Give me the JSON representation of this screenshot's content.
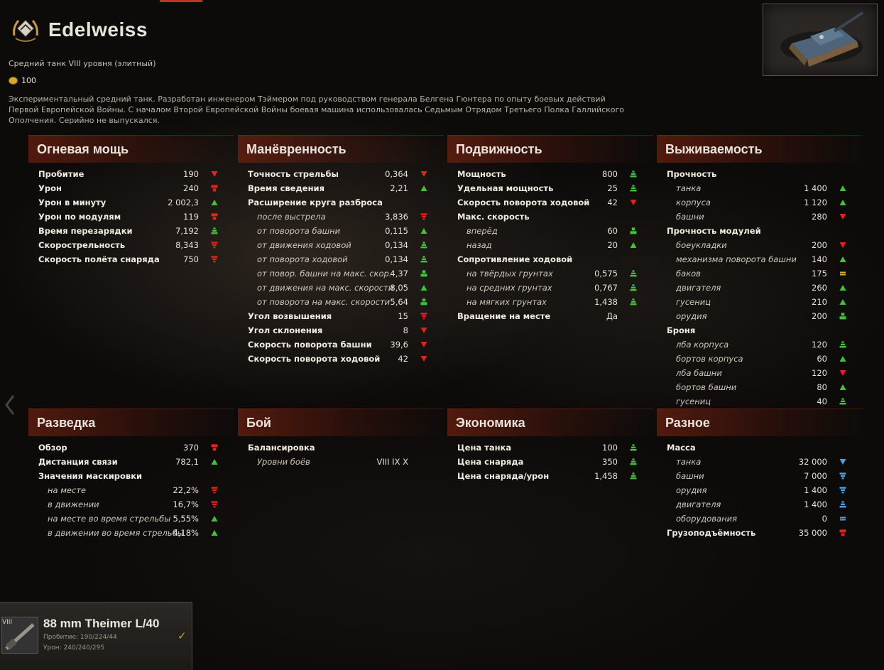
{
  "tank": {
    "name": "Edelweiss",
    "subtitle": "Средний танк VIII уровня (элитный)",
    "price": "100",
    "description": "Экспериментальный средний танк. Разработан инженером Тэймером под руководством генерала Белгена Гюнтера по опыту боевых действий Первой Европейской Войны. С началом Второй Европейской Войны боевая машина использовалась Седьмым Отрядом Третьего Полка Галлийского Ополчения. Серийно не выпускался."
  },
  "sections": {
    "firepower": {
      "title": "Огневая мощь",
      "rows": [
        {
          "label": "Пробитие",
          "value": "190",
          "ind": "down"
        },
        {
          "label": "Урон",
          "value": "240",
          "ind": "down2"
        },
        {
          "label": "Урон в минуту",
          "value": "2 002,3",
          "ind": "up"
        },
        {
          "label": "Урон по модулям",
          "value": "119",
          "ind": "down2"
        },
        {
          "label": "Время перезарядки",
          "value": "7,192",
          "ind": "up3"
        },
        {
          "label": "Скорострельность",
          "value": "8,343",
          "ind": "down3"
        },
        {
          "label": "Скорость полёта снаряда",
          "value": "750",
          "ind": "down3"
        }
      ]
    },
    "maneuver": {
      "title": "Манёвренность",
      "rows": [
        {
          "label": "Точность стрельбы",
          "value": "0,364",
          "ind": "down"
        },
        {
          "label": "Время сведения",
          "value": "2,21",
          "ind": "up"
        },
        {
          "label": "Расширение круга разброса",
          "value": "",
          "ind": ""
        },
        {
          "label": "после выстрела",
          "value": "3,836",
          "ind": "down3",
          "sub": true
        },
        {
          "label": "от поворота башни",
          "value": "0,115",
          "ind": "up",
          "sub": true
        },
        {
          "label": "от движения ходовой",
          "value": "0,134",
          "ind": "up3",
          "sub": true
        },
        {
          "label": "от поворота ходовой",
          "value": "0,134",
          "ind": "up3",
          "sub": true
        },
        {
          "label": "от повор. башни на макс. скор.",
          "value": "4,37",
          "ind": "up2",
          "sub": true
        },
        {
          "label": "от движения на макс. скорости",
          "value": "8,05",
          "ind": "up",
          "sub": true
        },
        {
          "label": "от поворота на макс. скорости",
          "value": "5,64",
          "ind": "up2",
          "sub": true
        },
        {
          "label": "Угол возвышения",
          "value": "15",
          "ind": "down3"
        },
        {
          "label": "Угол склонения",
          "value": "8",
          "ind": "down"
        },
        {
          "label": "Скорость поворота башни",
          "value": "39,6",
          "ind": "down"
        },
        {
          "label": "Скорость поворота ходовой",
          "value": "42",
          "ind": "down"
        }
      ]
    },
    "mobility": {
      "title": "Подвижность",
      "rows": [
        {
          "label": "Мощность",
          "value": "800",
          "ind": "up3"
        },
        {
          "label": "Удельная мощность",
          "value": "25",
          "ind": "up3"
        },
        {
          "label": "Скорость поворота ходовой",
          "value": "42",
          "ind": "down"
        },
        {
          "label": "Макс. скорость",
          "value": "",
          "ind": ""
        },
        {
          "label": "вперёд",
          "value": "60",
          "ind": "up2",
          "sub": true
        },
        {
          "label": "назад",
          "value": "20",
          "ind": "up",
          "sub": true
        },
        {
          "label": "Сопротивление ходовой",
          "value": "",
          "ind": ""
        },
        {
          "label": "на твёрдых грунтах",
          "value": "0,575",
          "ind": "up3",
          "sub": true
        },
        {
          "label": "на средних грунтах",
          "value": "0,767",
          "ind": "up3",
          "sub": true
        },
        {
          "label": "на мягких грунтах",
          "value": "1,438",
          "ind": "up3",
          "sub": true
        },
        {
          "label": "Вращение на месте",
          "value": "Да",
          "ind": ""
        }
      ]
    },
    "survivability": {
      "title": "Выживаемость",
      "rows": [
        {
          "label": "Прочность",
          "value": "",
          "ind": ""
        },
        {
          "label": "танка",
          "value": "1 400",
          "ind": "up",
          "sub": true
        },
        {
          "label": "корпуса",
          "value": "1 120",
          "ind": "up",
          "sub": true
        },
        {
          "label": "башни",
          "value": "280",
          "ind": "down",
          "sub": true
        },
        {
          "label": "Прочность модулей",
          "value": "",
          "ind": ""
        },
        {
          "label": "боеукладки",
          "value": "200",
          "ind": "down",
          "sub": true
        },
        {
          "label": "механизма поворота башни",
          "value": "140",
          "ind": "up",
          "sub": true
        },
        {
          "label": "баков",
          "value": "175",
          "ind": "equal_y",
          "sub": true
        },
        {
          "label": "двигателя",
          "value": "260",
          "ind": "up",
          "sub": true
        },
        {
          "label": "гусениц",
          "value": "210",
          "ind": "up",
          "sub": true
        },
        {
          "label": "орудия",
          "value": "200",
          "ind": "up2",
          "sub": true
        },
        {
          "label": "Броня",
          "value": "",
          "ind": ""
        },
        {
          "label": "лба корпуса",
          "value": "120",
          "ind": "up3",
          "sub": true
        },
        {
          "label": "бортов корпуса",
          "value": "60",
          "ind": "up",
          "sub": true
        },
        {
          "label": "лба башни",
          "value": "120",
          "ind": "down",
          "sub": true
        },
        {
          "label": "бортов башни",
          "value": "80",
          "ind": "up",
          "sub": true
        },
        {
          "label": "гусениц",
          "value": "40",
          "ind": "up3",
          "sub": true
        }
      ]
    },
    "recon": {
      "title": "Разведка",
      "rows": [
        {
          "label": "Обзор",
          "value": "370",
          "ind": "down2"
        },
        {
          "label": "Дистанция связи",
          "value": "782,1",
          "ind": "up"
        },
        {
          "label": "Значения маскировки",
          "value": "",
          "ind": ""
        },
        {
          "label": "на месте",
          "value": "22,2%",
          "ind": "down3",
          "sub": true
        },
        {
          "label": "в движении",
          "value": "16,7%",
          "ind": "down3",
          "sub": true
        },
        {
          "label": "на месте во время стрельбы",
          "value": "5,55%",
          "ind": "up",
          "sub": true
        },
        {
          "label": "в движении во время стрельбы",
          "value": "4,18%",
          "ind": "up",
          "sub": true
        }
      ]
    },
    "battle": {
      "title": "Бой",
      "rows": [
        {
          "label": "Балансировка",
          "value": "",
          "ind": ""
        },
        {
          "label": "Уровни боёв",
          "value": "VIII  IX  X",
          "ind": "",
          "sub": true
        }
      ]
    },
    "economy": {
      "title": "Экономика",
      "rows": [
        {
          "label": "Цена танка",
          "value": "100",
          "ind": "up3"
        },
        {
          "label": "Цена снаряда",
          "value": "350",
          "ind": "up3"
        },
        {
          "label": "Цена снаряда/урон",
          "value": "1,458",
          "ind": "up3"
        }
      ]
    },
    "misc": {
      "title": "Разное",
      "rows": [
        {
          "label": "Масса",
          "value": "",
          "ind": ""
        },
        {
          "label": "танка",
          "value": "32 000",
          "ind": "down_b",
          "sub": true
        },
        {
          "label": "башни",
          "value": "7 000",
          "ind": "down_b3",
          "sub": true
        },
        {
          "label": "орудия",
          "value": "1 400",
          "ind": "down_b3",
          "sub": true
        },
        {
          "label": "двигателя",
          "value": "1 400",
          "ind": "up_b3",
          "sub": true
        },
        {
          "label": "оборудования",
          "value": "0",
          "ind": "equal_b",
          "sub": true
        },
        {
          "label": "Грузоподъёмность",
          "value": "35 000",
          "ind": "down2"
        }
      ]
    }
  },
  "module": {
    "tier": "VIII",
    "name": "88 mm Theimer L/40",
    "pen": "Пробитие: 190/224/44",
    "dmg": "Урон: 240/240/295",
    "check": "✓"
  },
  "colors": {
    "up": "#3fc33a",
    "down": "#e2231a",
    "equal": "#e0b020",
    "blue": "#4aa0e0"
  }
}
